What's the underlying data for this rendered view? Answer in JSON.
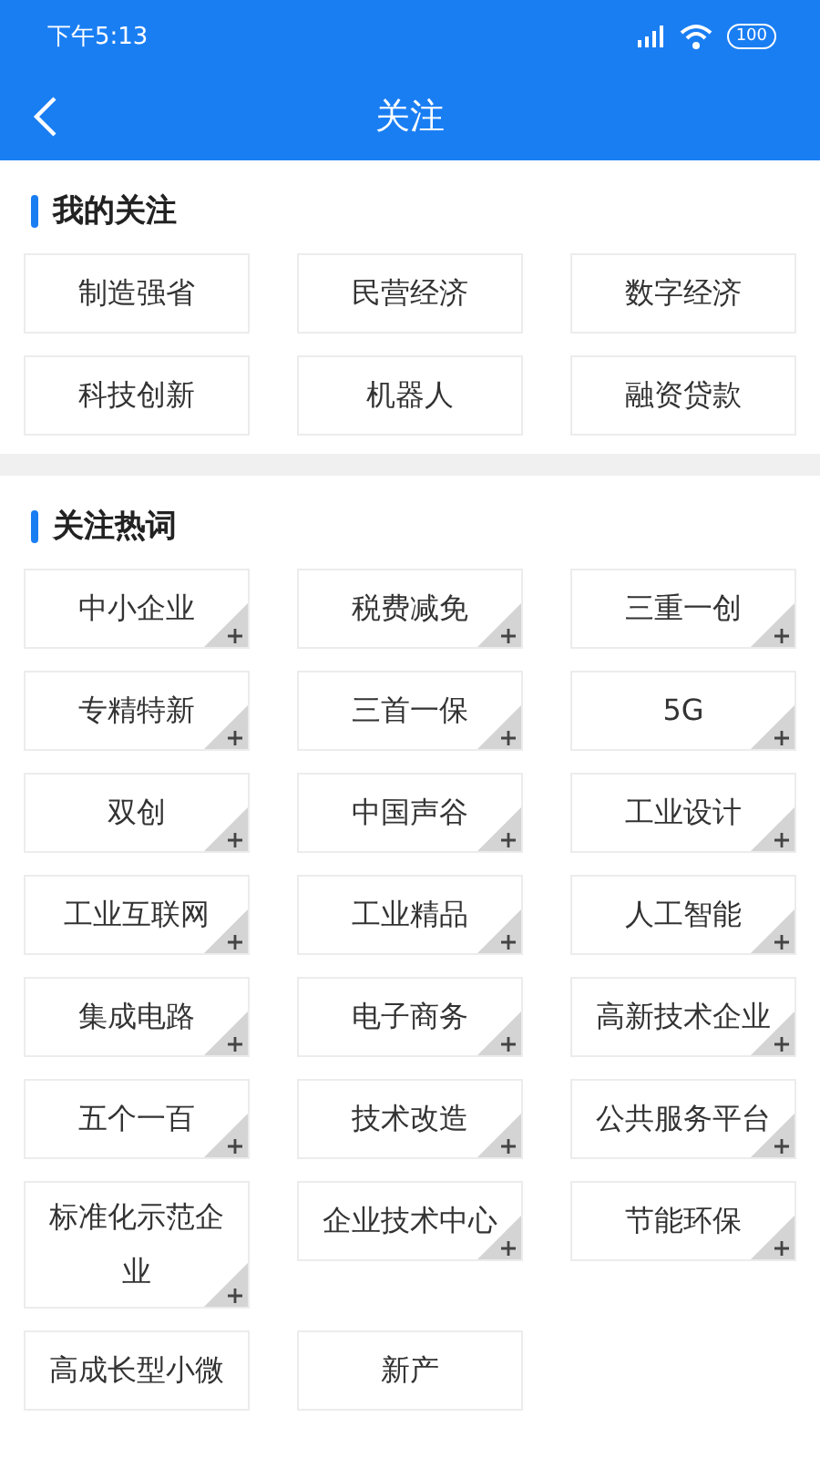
{
  "status_bar": {
    "time": "下午5:13",
    "battery": "100"
  },
  "header": {
    "title": "关注"
  },
  "my_follows": {
    "title": "我的关注",
    "items": [
      {
        "label": "制造强省"
      },
      {
        "label": "民营经济"
      },
      {
        "label": "数字经济"
      },
      {
        "label": "科技创新"
      },
      {
        "label": "机器人"
      },
      {
        "label": "融资贷款"
      }
    ]
  },
  "hot_words": {
    "title": "关注热词",
    "items": [
      {
        "label": "中小企业",
        "plus": true
      },
      {
        "label": "税费减免",
        "plus": true
      },
      {
        "label": "三重一创",
        "plus": true
      },
      {
        "label": "专精特新",
        "plus": true
      },
      {
        "label": "三首一保",
        "plus": true
      },
      {
        "label": "5G",
        "plus": true
      },
      {
        "label": "双创",
        "plus": true
      },
      {
        "label": "中国声谷",
        "plus": true
      },
      {
        "label": "工业设计",
        "plus": true
      },
      {
        "label": "工业互联网",
        "plus": true
      },
      {
        "label": "工业精品",
        "plus": true
      },
      {
        "label": "人工智能",
        "plus": true
      },
      {
        "label": "集成电路",
        "plus": true
      },
      {
        "label": "电子商务",
        "plus": true
      },
      {
        "label": "高新技术企业",
        "plus": true
      },
      {
        "label": "五个一百",
        "plus": true
      },
      {
        "label": "技术改造",
        "plus": true
      },
      {
        "label": "公共服务平台",
        "plus": true
      },
      {
        "label": "标准化示范企业",
        "plus": true
      },
      {
        "label": "企业技术中心",
        "plus": true
      },
      {
        "label": "节能环保",
        "plus": true
      },
      {
        "label": "高成长型小微",
        "plus": false
      },
      {
        "label": "新产",
        "plus": false
      }
    ]
  }
}
